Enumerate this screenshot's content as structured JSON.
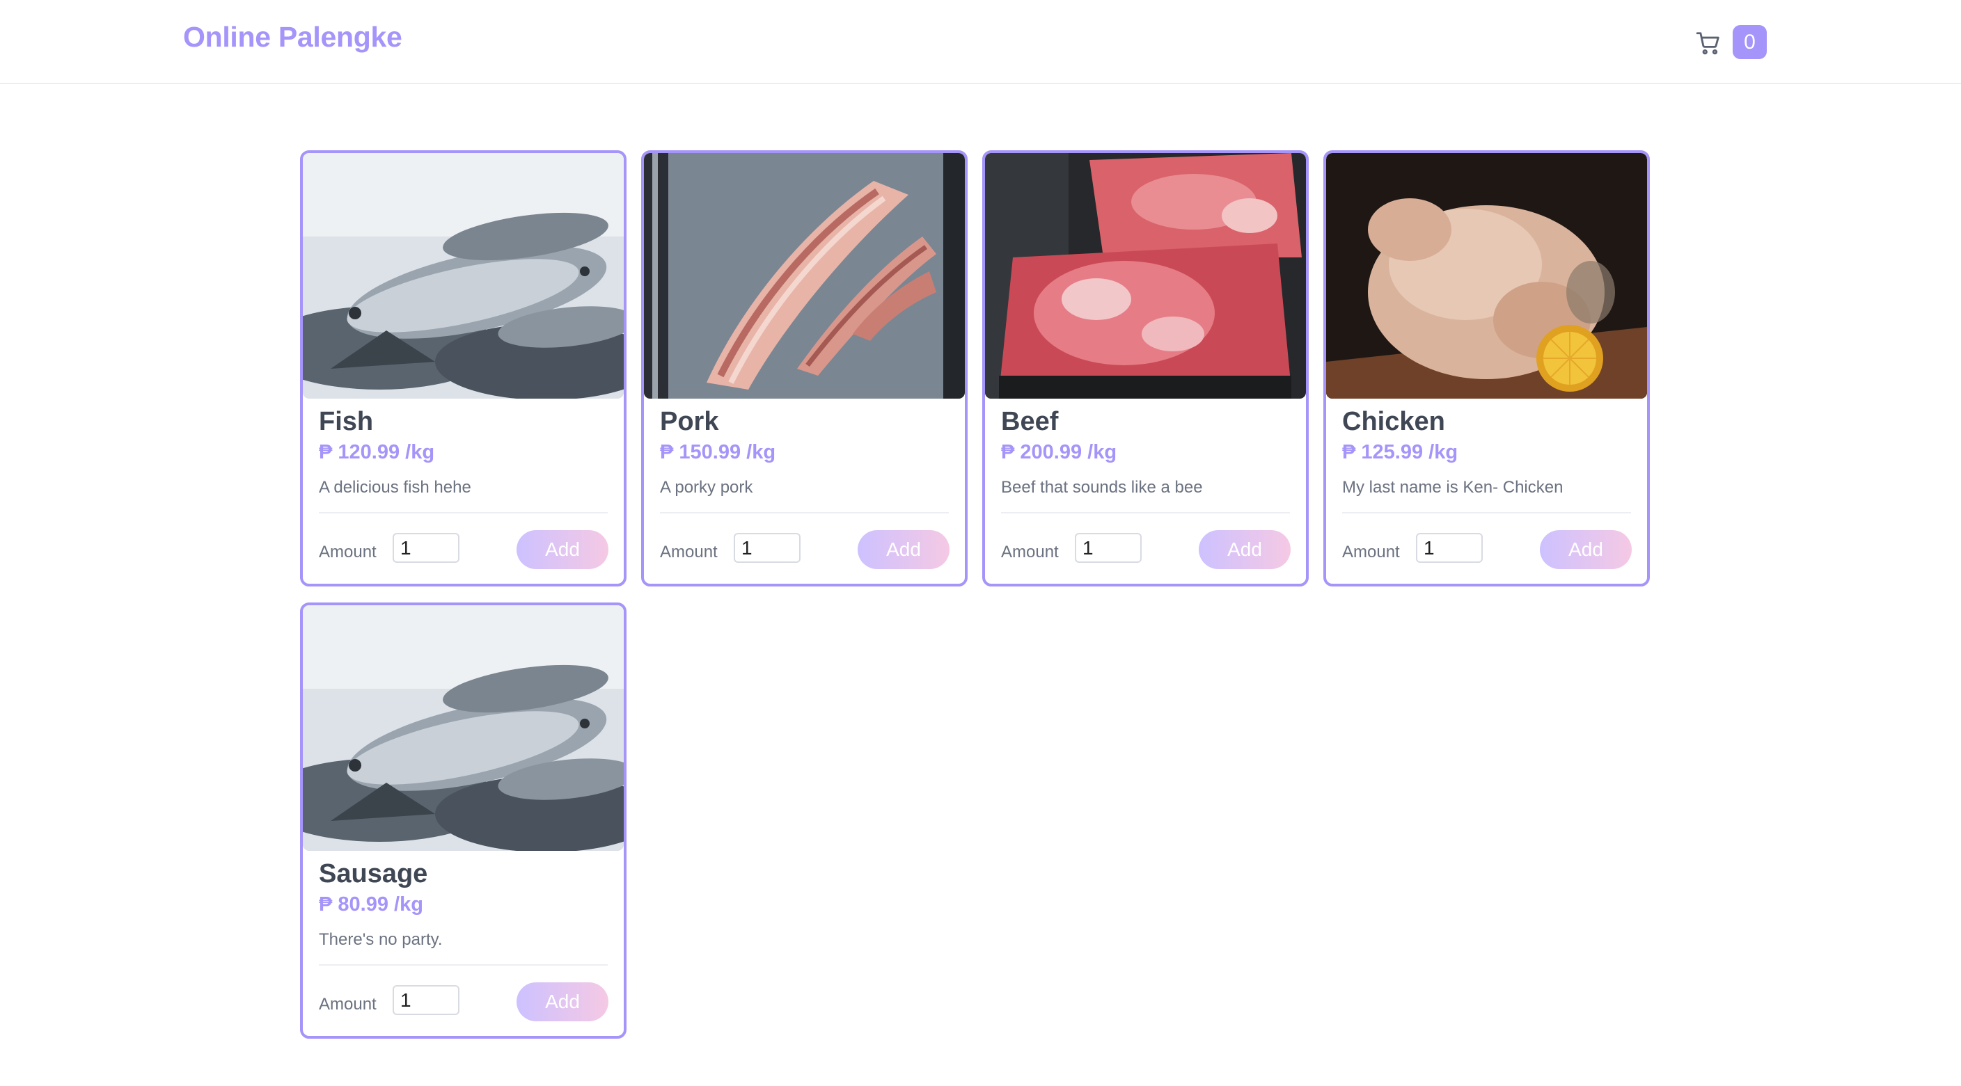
{
  "header": {
    "brand": "Online Palengke",
    "cart_count": "0",
    "cart_icon": "shopping-cart-icon"
  },
  "colors": {
    "accent": "#a594f9",
    "title_text": "#3f4654",
    "muted_text": "#6b7280",
    "button_gradient_start": "#cdc1ff",
    "button_gradient_end": "#f5c9e4"
  },
  "products": [
    {
      "name": "Fish",
      "price": "₱ 120.99 /kg",
      "description": "A delicious fish hehe",
      "amount_label": "Amount",
      "amount_value": "1",
      "add_label": "Add"
    },
    {
      "name": "Pork",
      "price": "₱ 150.99 /kg",
      "description": "A porky pork",
      "amount_label": "Amount",
      "amount_value": "1",
      "add_label": "Add"
    },
    {
      "name": "Beef",
      "price": "₱ 200.99 /kg",
      "description": "Beef that sounds like a bee",
      "amount_label": "Amount",
      "amount_value": "1",
      "add_label": "Add"
    },
    {
      "name": "Chicken",
      "price": "₱ 125.99 /kg",
      "description": "My last name is Ken- Chicken",
      "amount_label": "Amount",
      "amount_value": "1",
      "add_label": "Add"
    },
    {
      "name": "Sausage",
      "price": "₱ 80.99 /kg",
      "description": "There's no party.",
      "amount_label": "Amount",
      "amount_value": "1",
      "add_label": "Add"
    }
  ]
}
